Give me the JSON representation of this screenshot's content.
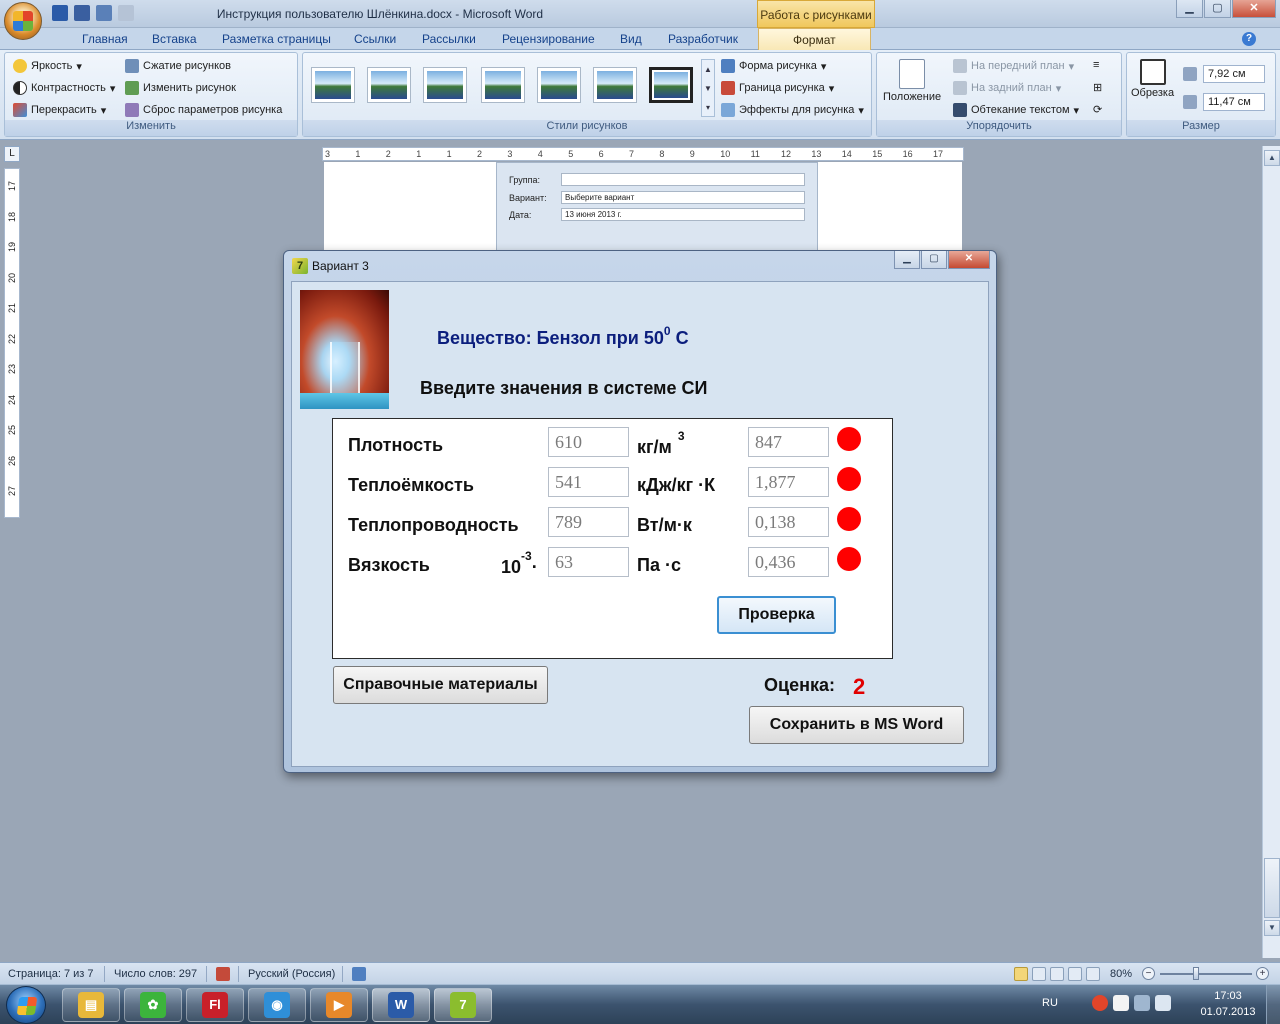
{
  "window": {
    "doc_title": "Инструкция пользователю Шлёнкина.docx - Microsoft Word",
    "contextual_tools": "Работа с рисунками",
    "controls": {
      "minimize": "▁",
      "maximize": "▢",
      "close": "✕"
    }
  },
  "tabs": [
    {
      "label": "Главная"
    },
    {
      "label": "Вставка"
    },
    {
      "label": "Разметка страницы"
    },
    {
      "label": "Ссылки"
    },
    {
      "label": "Рассылки"
    },
    {
      "label": "Рецензирование"
    },
    {
      "label": "Вид"
    },
    {
      "label": "Разработчик"
    },
    {
      "label": "Формат",
      "active": true
    }
  ],
  "ribbon": {
    "adjust": {
      "label": "Изменить",
      "brightness": "Яркость",
      "contrast": "Контрастность",
      "recolor": "Перекрасить",
      "compress": "Сжатие рисунков",
      "change": "Изменить рисунок",
      "reset": "Сброс параметров рисунка"
    },
    "styles": {
      "label": "Стили рисунков",
      "shape": "Форма рисунка",
      "border": "Граница рисунка",
      "effects": "Эффекты для рисунка"
    },
    "arrange": {
      "label": "Упорядочить",
      "position": "Положение",
      "bring_front": "На передний план",
      "send_back": "На задний план",
      "text_wrap": "Обтекание текстом"
    },
    "size": {
      "label": "Размер",
      "crop": "Обрезка",
      "height": "7,92 см",
      "width": "11,47 см"
    }
  },
  "rulers": {
    "horizontal": [
      "3",
      "1",
      "2",
      "1",
      "1",
      "2",
      "3",
      "4",
      "5",
      "6",
      "7",
      "8",
      "9",
      "10",
      "11",
      "12",
      "13",
      "14",
      "15",
      "16",
      "17"
    ],
    "vertical": [
      "17",
      "18",
      "19",
      "20",
      "21",
      "22",
      "23",
      "24",
      "25",
      "26",
      "27"
    ]
  },
  "embedded_form": {
    "group_label": "Группа:",
    "variant_label": "Вариант:",
    "variant_value": "Выберите вариант",
    "date_label": "Дата:",
    "date_value": "13     июня     2013 г."
  },
  "dialog": {
    "title": "Вариант 3",
    "substance_prefix": "Вещество: Бензол при  50",
    "substance_degree": "0",
    "substance_suffix": " С",
    "instruction": "Введите значения в системе СИ",
    "properties": [
      {
        "label": "Плотность",
        "factor": "",
        "factor_exp": "",
        "input": "610",
        "unit": "кг/м",
        "unit_exp": "3",
        "answer": "847",
        "status_color": "#ff0000"
      },
      {
        "label": "Теплоёмкость",
        "factor": "",
        "factor_exp": "",
        "input": "541",
        "unit": "кДж/кг ·К",
        "unit_exp": "",
        "answer": "1,877",
        "status_color": "#ff0000"
      },
      {
        "label": "Теплопроводность",
        "factor": "",
        "factor_exp": "",
        "input": "789",
        "unit": "Вт/м·к",
        "unit_exp": "",
        "answer": "0,138",
        "status_color": "#ff0000"
      },
      {
        "label": "Вязкость",
        "factor": "10",
        "factor_exp": "-3",
        "input": "63",
        "unit": "Па ·с",
        "unit_exp": "",
        "answer": "0,436",
        "status_color": "#ff0000"
      }
    ],
    "factor_dot": "·",
    "check_button": "Проверка",
    "reference_button": "Справочные материалы",
    "grade_label": "Оценка:",
    "grade_value": "2",
    "save_button": "Сохранить в MS Word"
  },
  "statusbar": {
    "page": "Страница: 7 из 7",
    "words": "Число слов: 297",
    "language": "Русский (Россия)",
    "zoom": "80%",
    "zoom_level": 0.8
  },
  "taskbar": {
    "apps": [
      {
        "name": "explorer",
        "glyph": "▤",
        "color": "#e8b83a"
      },
      {
        "name": "icq",
        "glyph": "✿",
        "color": "#3cb43c"
      },
      {
        "name": "flash",
        "glyph": "Fl",
        "color": "#c8202a"
      },
      {
        "name": "chrome",
        "glyph": "◉",
        "color": "#2f8fd8"
      },
      {
        "name": "media",
        "glyph": "▶",
        "color": "#e7882a"
      },
      {
        "name": "word",
        "glyph": "W",
        "color": "#2b5ba8"
      },
      {
        "name": "app",
        "glyph": "7",
        "color": "#8bbd2e"
      }
    ],
    "language": "RU",
    "time": "17:03",
    "date": "01.07.2013"
  }
}
